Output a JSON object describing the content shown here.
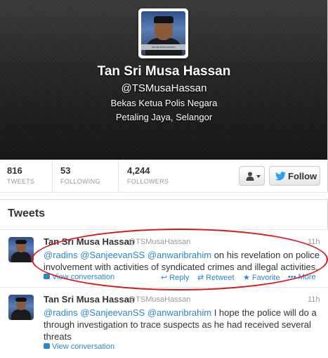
{
  "profile": {
    "name": "Tan Sri Musa Hassan",
    "handle": "@TSMusaHassan",
    "bio": "Bekas Ketua Polis Negara",
    "location": "Petaling Jaya, Selangor",
    "avatar_caption": "TAN SRI MUSA HASSAN"
  },
  "stats": [
    {
      "count": "816",
      "label": "TWEETS"
    },
    {
      "count": "53",
      "label": "FOLLOWING"
    },
    {
      "count": "4,244",
      "label": "FOLLOWERS"
    }
  ],
  "actions": {
    "user_menu_icon": "person-icon",
    "follow_label": "Follow"
  },
  "tweets_module": {
    "heading": "Tweets",
    "items": [
      {
        "author": "Tan Sri Musa Hassan",
        "handle": "@TSMusaHassan",
        "time": "11h",
        "mentions": [
          "@radins",
          "@SanjeevanSS",
          "@anwaribrahim"
        ],
        "body": " on his revelation on police involvement with activities of syndicated crimes and illegal activities.",
        "view_conversation": "View conversation",
        "reply": "Reply",
        "retweet": "Retweet",
        "favorite": "Favorite",
        "more": "More"
      },
      {
        "author": "Tan Sri Musa Hassan",
        "handle": "@TSMusaHassan",
        "time": "11h",
        "mentions": [
          "@radins",
          "@SanjeevanSS",
          "@anwaribrahim"
        ],
        "body": " I hope the police will do a through investigation to trace suspects as he had received several threats",
        "view_conversation": "View conversation"
      }
    ]
  },
  "colors": {
    "link": "#2a88c6",
    "highlight": "#d9141c",
    "header_dark": "#1f1f1f"
  }
}
